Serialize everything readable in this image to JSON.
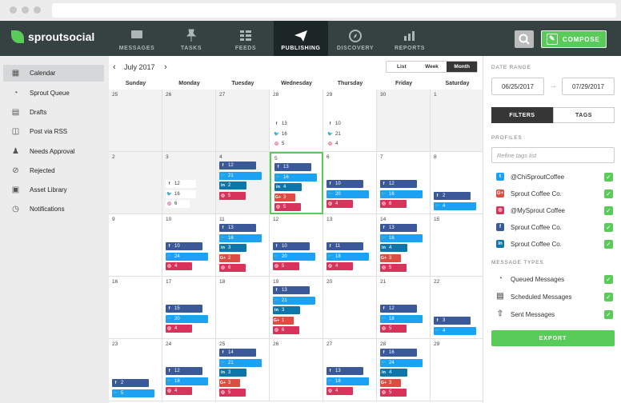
{
  "nav": {
    "items": [
      {
        "label": "MESSAGES",
        "icon": "messages-icon"
      },
      {
        "label": "TASKS",
        "icon": "pin-icon"
      },
      {
        "label": "FEEDS",
        "icon": "feeds-icon"
      },
      {
        "label": "PUBLISHING",
        "icon": "paper-plane-icon",
        "active": true
      },
      {
        "label": "DISCOVERY",
        "icon": "compass-icon"
      },
      {
        "label": "REPORTS",
        "icon": "bar-chart-icon"
      }
    ],
    "compose_label": "COMPOSE",
    "logo": "sproutsocial"
  },
  "sidebar": {
    "items": [
      {
        "label": "Calendar",
        "icon": "calendar-icon"
      },
      {
        "label": "Sprout Queue",
        "icon": "queue-icon"
      },
      {
        "label": "Drafts",
        "icon": "drafts-icon"
      },
      {
        "label": "Post via RSS",
        "icon": "rss-icon"
      },
      {
        "label": "Needs Approval",
        "icon": "approval-icon"
      },
      {
        "label": "Rejected",
        "icon": "rejected-icon"
      },
      {
        "label": "Asset Library",
        "icon": "asset-icon"
      },
      {
        "label": "Notifications",
        "icon": "bell-icon"
      }
    ]
  },
  "calendar": {
    "month": "July 2017",
    "views": [
      "List",
      "Week",
      "Month"
    ],
    "days": [
      "Sunday",
      "Monday",
      "Tuesday",
      "Wednesday",
      "Thursday",
      "Friday",
      "Saturday"
    ],
    "weeks": [
      [
        {
          "n": "25"
        },
        {
          "n": "26"
        },
        {
          "n": "27"
        },
        {
          "n": "28",
          "chips": [
            [
              "fb",
              "13"
            ],
            [
              "tw",
              "16"
            ],
            [
              "ig",
              "5"
            ]
          ]
        },
        {
          "n": "29",
          "chips": [
            [
              "fb",
              "10"
            ],
            [
              "tw",
              "21"
            ],
            [
              "ig",
              "4"
            ]
          ]
        },
        {
          "n": "30"
        },
        {
          "n": "1"
        }
      ],
      [
        {
          "n": "2"
        },
        {
          "n": "3",
          "chips": [
            [
              "fb",
              "12"
            ],
            [
              "tw",
              "16"
            ],
            [
              "ig",
              "6"
            ]
          ]
        },
        {
          "n": "4",
          "chips": [
            [
              "fb",
              "12"
            ],
            [
              "tw",
              "21"
            ],
            [
              "li",
              "2"
            ],
            [
              "ig",
              "5"
            ]
          ]
        },
        {
          "n": "5",
          "chips": [
            [
              "fb",
              "13"
            ],
            [
              "tw",
              "16"
            ],
            [
              "li",
              "4"
            ],
            [
              "gp",
              "3"
            ],
            [
              "ig",
              "5"
            ]
          ]
        },
        {
          "n": "6",
          "chips": [
            [
              "fb",
              "10"
            ],
            [
              "tw",
              "20"
            ],
            [
              "ig",
              "4"
            ]
          ]
        },
        {
          "n": "7",
          "chips": [
            [
              "fb",
              "12"
            ],
            [
              "tw",
              "16"
            ],
            [
              "ig",
              "6"
            ]
          ]
        },
        {
          "n": "8",
          "chips": [
            [
              "fb",
              "2"
            ],
            [
              "tw",
              "4"
            ]
          ]
        }
      ],
      [
        {
          "n": "9"
        },
        {
          "n": "10",
          "chips": [
            [
              "fb",
              "10"
            ],
            [
              "tw",
              "24"
            ],
            [
              "ig",
              "4"
            ]
          ]
        },
        {
          "n": "11",
          "chips": [
            [
              "fb",
              "13"
            ],
            [
              "tw",
              "16"
            ],
            [
              "li",
              "3"
            ],
            [
              "gp",
              "2"
            ],
            [
              "ig",
              "6"
            ]
          ]
        },
        {
          "n": "12",
          "chips": [
            [
              "fb",
              "10"
            ],
            [
              "tw",
              "20"
            ],
            [
              "ig",
              "5"
            ]
          ]
        },
        {
          "n": "13",
          "chips": [
            [
              "fb",
              "11"
            ],
            [
              "tw",
              "18"
            ],
            [
              "ig",
              "4"
            ]
          ]
        },
        {
          "n": "14",
          "chips": [
            [
              "fb",
              "13"
            ],
            [
              "tw",
              "16"
            ],
            [
              "li",
              "4"
            ],
            [
              "gp",
              "3"
            ],
            [
              "ig",
              "5"
            ]
          ]
        },
        {
          "n": "15"
        }
      ],
      [
        {
          "n": "16"
        },
        {
          "n": "17",
          "chips": [
            [
              "fb",
              "15"
            ],
            [
              "tw",
              "20"
            ],
            [
              "ig",
              "4"
            ]
          ]
        },
        {
          "n": "18"
        },
        {
          "n": "19",
          "chips": [
            [
              "fb",
              "13"
            ],
            [
              "tw",
              "21"
            ],
            [
              "li",
              "3"
            ],
            [
              "gp",
              "1"
            ],
            [
              "ig",
              "6"
            ]
          ]
        },
        {
          "n": "20"
        },
        {
          "n": "21",
          "chips": [
            [
              "fb",
              "12"
            ],
            [
              "tw",
              "18"
            ],
            [
              "ig",
              "5"
            ]
          ]
        },
        {
          "n": "22",
          "chips": [
            [
              "fb",
              "3"
            ],
            [
              "tw",
              "4"
            ]
          ]
        }
      ],
      [
        {
          "n": "23",
          "chips": [
            [
              "fb",
              "2"
            ],
            [
              "tw",
              "5"
            ]
          ]
        },
        {
          "n": "24",
          "chips": [
            [
              "fb",
              "12"
            ],
            [
              "tw",
              "18"
            ],
            [
              "ig",
              "4"
            ]
          ]
        },
        {
          "n": "25",
          "chips": [
            [
              "fb",
              "14"
            ],
            [
              "tw",
              "21"
            ],
            [
              "li",
              "3"
            ],
            [
              "gp",
              "3"
            ],
            [
              "ig",
              "5"
            ]
          ]
        },
        {
          "n": "26"
        },
        {
          "n": "27",
          "chips": [
            [
              "fb",
              "13"
            ],
            [
              "tw",
              "18"
            ],
            [
              "ig",
              "4"
            ]
          ]
        },
        {
          "n": "28",
          "chips": [
            [
              "fb",
              "16"
            ],
            [
              "tw",
              "24"
            ],
            [
              "li",
              "4"
            ],
            [
              "gp",
              "3"
            ],
            [
              "ig",
              "5"
            ]
          ]
        },
        {
          "n": "29"
        }
      ]
    ]
  },
  "right": {
    "date_range_label": "DATE RANGE",
    "start": "06/25/2017",
    "end": "07/29/2017",
    "tabs": [
      "FILTERS",
      "TAGS"
    ],
    "profiles_label": "PROFILES",
    "refine_placeholder": "Refine tags list",
    "profiles": [
      {
        "name": "@ChiSproutCoffee",
        "net": "tw"
      },
      {
        "name": "Sprout Coffee Co.",
        "net": "gp"
      },
      {
        "name": "@MySprout Coffee",
        "net": "ig"
      },
      {
        "name": "Sprout Coffee Co.",
        "net": "fb"
      },
      {
        "name": "Sprout Coffee Co.",
        "net": "li"
      }
    ],
    "types_label": "MESSAGE TYPES",
    "types": [
      "Queued Messages",
      "Scheduled Messages",
      "Sent Messages"
    ],
    "export": "EXPORT"
  },
  "colors": {
    "fb": "#3b5998",
    "tw": "#1da1f2",
    "li": "#0e76a8",
    "gp": "#dc4e41",
    "ig": "#d8335b",
    "accent": "#59cb59"
  }
}
